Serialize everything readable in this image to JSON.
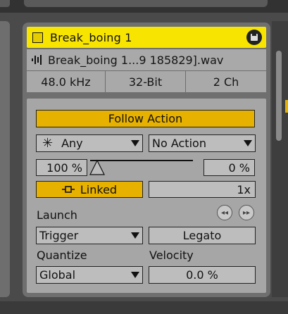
{
  "clip": {
    "title": "Break_boing 1",
    "file_name": "Break_boing 1...9 185829].wav",
    "sample_rate": "48.0 kHz",
    "bit_depth": "32-Bit",
    "channels": "2 Ch",
    "color": "#f7e400"
  },
  "follow_action": {
    "button_label": "Follow Action",
    "action_a": "Any",
    "action_b": "No Action",
    "chance_a": "100 %",
    "chance_b": "0 %",
    "linked_label": "Linked",
    "multiplier": "1x"
  },
  "launch": {
    "label": "Launch",
    "mode": "Trigger",
    "legato_label": "Legato",
    "quantize_label": "Quantize",
    "quantize_value": "Global",
    "velocity_label": "Velocity",
    "velocity_value": "0.0 %"
  },
  "icons": {
    "save": "save-icon",
    "waveform": "waveform-icon",
    "any": "asterisk-icon",
    "link": "link-icon",
    "nudge_back": "rewind-icon",
    "nudge_forward": "fast-forward-icon"
  },
  "colors": {
    "accent": "#e7b100",
    "title_yellow": "#f7e400"
  }
}
